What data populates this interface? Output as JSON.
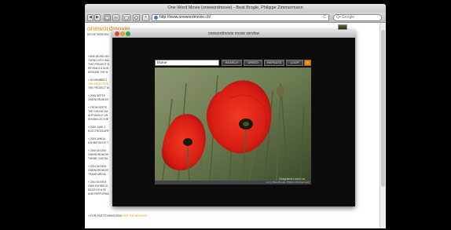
{
  "window": {
    "title": "One Word Movie (onewordmovie) - Beat Brogle, Philippe Zimmermann"
  },
  "toolbar": {
    "back": "◀",
    "forward": "▶",
    "add": "+",
    "url": "http://www.onewordmovie.ch/",
    "reload": "C",
    "search_placeholder": "Q• Google"
  },
  "site": {
    "logo": "onewordmovie",
    "subnav": "MOVIE WINDOW",
    "intro_lines": [
      "»ONE WORD MO",
      "TURNS INTO IMA",
      "THIS PROJECT B",
      "REVEALS A SLID",
      "AROUND THE M"
    ],
    "news_groups": [
      {
        "lines": [
          "» NOVEMBER 2",
          "THE SELECTION",
          "THE PROJECT W"
        ],
        "highlight": 1
      },
      {
        "lines": [
          "» 2005 SEPTE",
          "ONEWORDMOVI"
        ],
        "highlight": -1
      },
      {
        "lines": [
          "» FROM SEPTE",
          "THE ONLINE DA",
          "ALPHAVILLE UN",
          "SHOWN ON THE"
        ],
        "highlight": -1
      },
      {
        "lines": [
          "» 2005 JUNE 2",
          "ELECTROSCAPE"
        ],
        "highlight": -1
      },
      {
        "lines": [
          "» 2005 JANUA",
          "EXHIBITION AT T"
        ],
        "highlight": -1
      },
      {
        "lines": [
          "» 2005 DECEM",
          "ONEWORDMOVI",
          "THEME: DIGITAL"
        ],
        "highlight": -1
      },
      {
        "lines": [
          "» 2004 NOVEM",
          "ONEWORDMOVI",
          "TRANS-MEDIA"
        ],
        "highlight": -1
      },
      {
        "lines": [
          "» 2004 NOVEM",
          "OWN EXHIBITIO",
          "DEATH IS A PE",
          "AND PERFORMA"
        ],
        "highlight": -1
      }
    ],
    "footer_prefix": "» FOR PAST EXHIBITIONS",
    "footer_link": "SEE THE ARCHIVE"
  },
  "modal": {
    "title": "onewordmovie movie window",
    "word_value": "blume",
    "buttons": [
      "SEARCH",
      "SPEED",
      "REPEATS",
      "LOOP"
    ],
    "go_label": "»",
    "watermark": "Diagramm.com.ua",
    "credit": "ca. by Beat Brogle, Philippe Zimmermann"
  },
  "colors": {
    "brand_orange": "#e68a00",
    "poppy_red": "#d81d14",
    "modal_bg": "#0c0c0c"
  }
}
